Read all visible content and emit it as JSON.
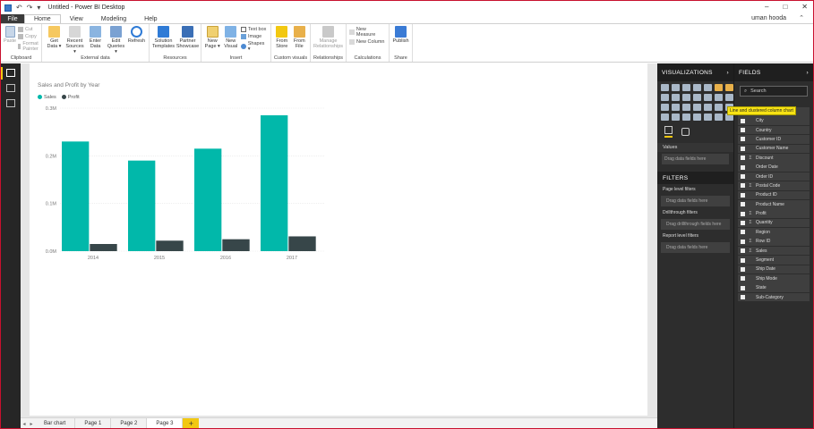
{
  "window": {
    "title": "Untitled - Power BI Desktop",
    "user": "uman hooda",
    "controls": [
      "–",
      "□",
      "✕"
    ]
  },
  "tabs": {
    "file": "File",
    "items": [
      "Home",
      "View",
      "Modeling",
      "Help"
    ]
  },
  "ribbon": {
    "clipboard": {
      "label": "Clipboard",
      "paste": "Paste",
      "cut": "Cut",
      "copy": "Copy",
      "format_painter": "Format Painter"
    },
    "external": {
      "label": "External data",
      "get_data": "Get Data ▾",
      "recent_sources": "Recent Sources ▾",
      "enter_data": "Enter Data",
      "edit_queries": "Edit Queries ▾",
      "refresh": "Refresh"
    },
    "resources": {
      "label": "Resources",
      "solution_templates": "Solution Templates",
      "partner_showcase": "Partner Showcase"
    },
    "insert": {
      "label": "Insert",
      "new_page": "New Page ▾",
      "new_visual": "New Visual",
      "text_box": "Text box",
      "image": "Image",
      "shapes": "Shapes ▾"
    },
    "custom_visuals": {
      "label": "Custom visuals",
      "from_store": "From Store",
      "from_file": "From File"
    },
    "relationships": {
      "label": "Relationships",
      "manage": "Manage Relationships"
    },
    "calculations": {
      "label": "Calculations",
      "new_measure": "New Measure",
      "new_column": "New Column"
    },
    "share": {
      "label": "Share",
      "publish": "Publish"
    }
  },
  "chart_data": {
    "type": "bar",
    "title": "Sales and Profit by Year",
    "categories": [
      "2014",
      "2015",
      "2016",
      "2017"
    ],
    "series": [
      {
        "name": "Sales",
        "color": "#01b8aa",
        "values": [
          0.23,
          0.19,
          0.215,
          0.285
        ]
      },
      {
        "name": "Profit",
        "color": "#374649",
        "values": [
          0.015,
          0.022,
          0.025,
          0.031
        ]
      }
    ],
    "yticks": [
      "0.0M",
      "0.1M",
      "0.2M",
      "0.3M"
    ],
    "ylim": [
      0,
      0.3
    ],
    "legend_position": "top-left",
    "grid": true
  },
  "page_tabs": {
    "items": [
      "Bar chart",
      "Page 1",
      "Page 2",
      "Page 3"
    ],
    "active": "Page 3",
    "add": "+"
  },
  "visualizations": {
    "header": "VISUALIZATIONS",
    "tooltip": "Line and clustered column chart",
    "values_label": "Values",
    "drag_hint": "Drag data fields here"
  },
  "filters": {
    "header": "FILTERS",
    "page_level": "Page level filters",
    "drag1": "Drag data fields here",
    "drillthrough": "Drillthrough filters",
    "drag_drill": "Drag drillthrough fields here",
    "report_level": "Report level filters",
    "drag2": "Drag data fields here"
  },
  "fields": {
    "header": "FIELDS",
    "search_placeholder": "Search",
    "items": [
      {
        "name": "Category",
        "sigma": false
      },
      {
        "name": "City",
        "sigma": false
      },
      {
        "name": "Country",
        "sigma": false
      },
      {
        "name": "Customer ID",
        "sigma": false
      },
      {
        "name": "Customer Name",
        "sigma": false
      },
      {
        "name": "Discount",
        "sigma": true
      },
      {
        "name": "Order Date",
        "sigma": false
      },
      {
        "name": "Order ID",
        "sigma": false
      },
      {
        "name": "Postal Code",
        "sigma": true
      },
      {
        "name": "Product ID",
        "sigma": false
      },
      {
        "name": "Product Name",
        "sigma": false
      },
      {
        "name": "Profit",
        "sigma": true
      },
      {
        "name": "Quantity",
        "sigma": true
      },
      {
        "name": "Region",
        "sigma": false
      },
      {
        "name": "Row ID",
        "sigma": true
      },
      {
        "name": "Sales",
        "sigma": true
      },
      {
        "name": "Segment",
        "sigma": false
      },
      {
        "name": "Ship Date",
        "sigma": false
      },
      {
        "name": "Ship Mode",
        "sigma": false
      },
      {
        "name": "State",
        "sigma": false
      },
      {
        "name": "Sub-Category",
        "sigma": false
      }
    ]
  }
}
